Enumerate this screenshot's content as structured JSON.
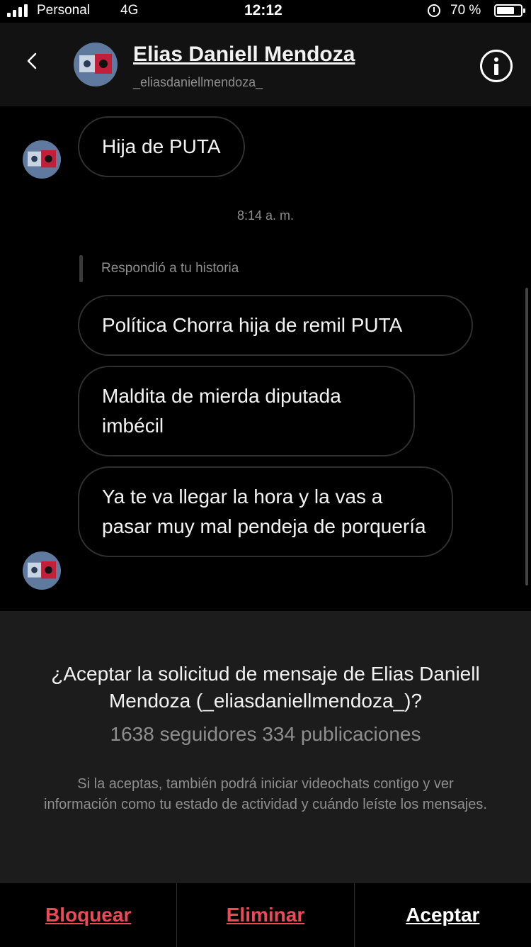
{
  "status_bar": {
    "carrier": "Personal",
    "network": "4G",
    "time": "12:12",
    "battery": "70 %"
  },
  "header": {
    "name": "Elias Daniell Mendoza",
    "username": "_eliasdaniellmendoza_",
    "back_icon": "chevron-left-icon",
    "info_icon": "info-icon"
  },
  "chat": {
    "messages_top": [
      {
        "text": "Hija de PUTA"
      }
    ],
    "timestamp": "8:14 a. m.",
    "reply_label": "Respondió a tu historia",
    "messages_bottom": [
      {
        "text": "Política Chorra hija de remil PUTA"
      },
      {
        "text": "Maldita de mierda diputada imbécil"
      },
      {
        "text": "Ya te va llegar la hora y la vas a pasar muy mal pendeja de porquería"
      }
    ]
  },
  "request": {
    "title": "¿Aceptar la solicitud de mensaje de Elias Daniell Mendoza (_eliasdaniellmendoza_)?",
    "stats": "1638 seguidores 334 publicaciones",
    "note": "Si la aceptas, también podrá iniciar videochats contigo y ver información como tu estado de actividad y cuándo leíste los mensajes."
  },
  "actions": {
    "block": "Bloquear",
    "delete": "Eliminar",
    "accept": "Aceptar"
  },
  "colors": {
    "destructive": "#ed4956",
    "background": "#000000",
    "panel": "#1c1c1c",
    "muted_text": "#8e8e8e"
  }
}
